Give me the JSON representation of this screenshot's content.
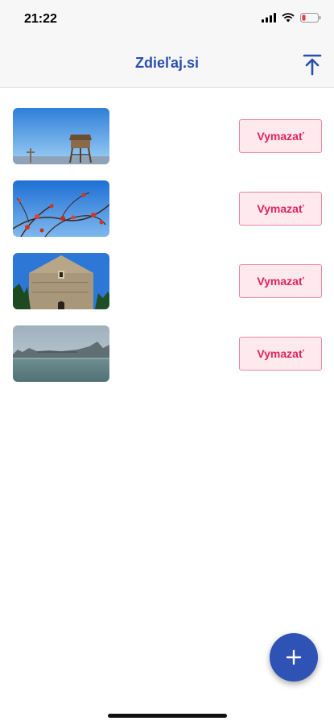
{
  "status_bar": {
    "time": "21:22"
  },
  "nav": {
    "title": "Zdieľaj.si",
    "upload_icon": "upload-icon"
  },
  "photos": [
    {
      "description_icon": "photo-watchtower",
      "delete_label": "Vymazať"
    },
    {
      "description_icon": "photo-rosehips",
      "delete_label": "Vymazať"
    },
    {
      "description_icon": "photo-stone-building",
      "delete_label": "Vymazať"
    },
    {
      "description_icon": "photo-foggy-river",
      "delete_label": "Vymazať"
    }
  ],
  "fab": {
    "icon": "plus-icon"
  },
  "colors": {
    "brand": "#2a4fae",
    "fab": "#2f52b5",
    "delete_text": "#e0245e",
    "delete_bg": "#fde9ee",
    "delete_border": "#e8889f"
  }
}
